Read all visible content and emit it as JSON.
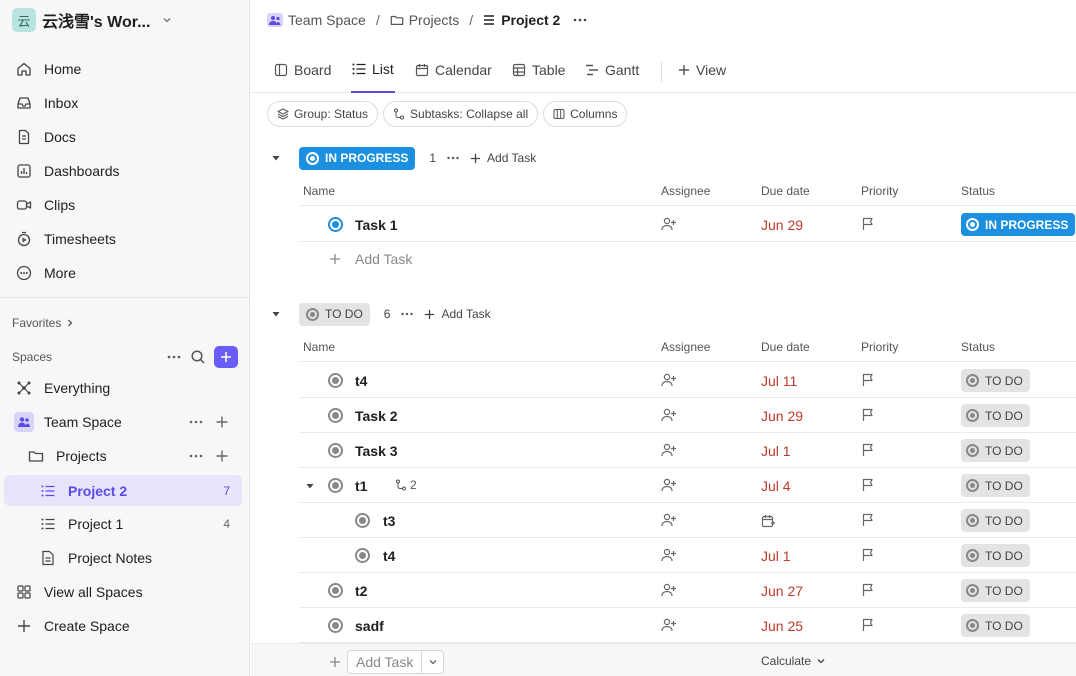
{
  "workspace": {
    "logo": "云",
    "name": "云浅雪's Wor..."
  },
  "nav": [
    {
      "label": "Home",
      "icon": "home-icon"
    },
    {
      "label": "Inbox",
      "icon": "inbox-icon"
    },
    {
      "label": "Docs",
      "icon": "docs-icon"
    },
    {
      "label": "Dashboards",
      "icon": "dashboards-icon"
    },
    {
      "label": "Clips",
      "icon": "clips-icon"
    },
    {
      "label": "Timesheets",
      "icon": "timesheets-icon"
    },
    {
      "label": "More",
      "icon": "more-icon"
    }
  ],
  "favorites": {
    "label": "Favorites"
  },
  "spaces": {
    "label": "Spaces",
    "everything": "Everything",
    "team_space": "Team Space",
    "projects": "Projects",
    "items": [
      {
        "label": "Project 2",
        "count": "7"
      },
      {
        "label": "Project 1",
        "count": "4"
      },
      {
        "label": "Project Notes",
        "count": ""
      }
    ],
    "view_all": "View all Spaces",
    "create": "Create Space"
  },
  "breadcrumb": {
    "space": "Team Space",
    "folder": "Projects",
    "list": "Project 2",
    "sep": "/"
  },
  "tabs": [
    {
      "label": "Board"
    },
    {
      "label": "List"
    },
    {
      "label": "Calendar"
    },
    {
      "label": "Table"
    },
    {
      "label": "Gantt"
    },
    {
      "label": "View"
    }
  ],
  "chips": [
    "Group: Status",
    "Subtasks: Collapse all",
    "Columns"
  ],
  "columns": {
    "name": "Name",
    "assignee": "Assignee",
    "due": "Due date",
    "priority": "Priority",
    "status": "Status"
  },
  "add_task": "Add Task",
  "groups": {
    "in_progress": {
      "label": "IN PROGRESS",
      "count": "1",
      "color": "#1b8fe0",
      "tasks": [
        {
          "name": "Task 1",
          "due": "Jun 29",
          "status": "IN PROGRESS"
        }
      ]
    },
    "todo": {
      "label": "TO DO",
      "count": "6",
      "color": "#888888",
      "tasks": [
        {
          "name": "t4",
          "due": "Jul 11",
          "status": "TO DO"
        },
        {
          "name": "Task 2",
          "due": "Jun 29",
          "status": "TO DO"
        },
        {
          "name": "Task 3",
          "due": "Jul 1",
          "status": "TO DO"
        },
        {
          "name": "t1",
          "due": "Jul 4",
          "status": "TO DO",
          "subtasks": "2"
        },
        {
          "name": "t3",
          "due": "",
          "status": "TO DO"
        },
        {
          "name": "t4",
          "due": "Jul 1",
          "status": "TO DO"
        },
        {
          "name": "t2",
          "due": "Jun 27",
          "status": "TO DO"
        },
        {
          "name": "sadf",
          "due": "Jun 25",
          "status": "TO DO"
        }
      ]
    }
  },
  "footer": {
    "add_task": "Add Task",
    "calculate": "Calculate"
  },
  "colors": {
    "accent": "#6a5cf6",
    "due_red": "#c0392b",
    "in_progress": "#1b8fe0"
  }
}
